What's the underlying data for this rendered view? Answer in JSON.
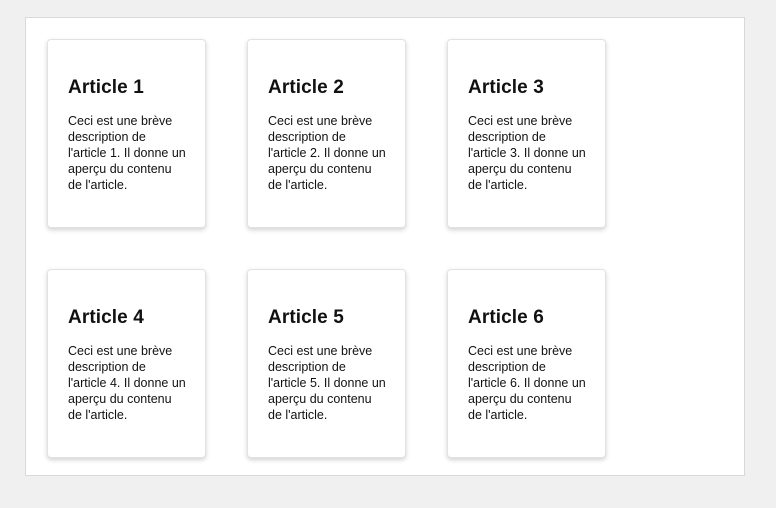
{
  "articles": [
    {
      "title": "Article 1",
      "description": "Ceci est une brève description de l'article 1. Il donne un aperçu du contenu de l'article."
    },
    {
      "title": "Article 2",
      "description": "Ceci est une brève description de l'article 2. Il donne un aperçu du contenu de l'article."
    },
    {
      "title": "Article 3",
      "description": "Ceci est une brève description de l'article 3. Il donne un aperçu du contenu de l'article."
    },
    {
      "title": "Article 4",
      "description": "Ceci est une brève description de l'article 4. Il donne un aperçu du contenu de l'article."
    },
    {
      "title": "Article 5",
      "description": "Ceci est une brève description de l'article 5. Il donne un aperçu du contenu de l'article."
    },
    {
      "title": "Article 6",
      "description": "Ceci est une brève description de l'article 6. Il donne un aperçu du contenu de l'article."
    }
  ]
}
